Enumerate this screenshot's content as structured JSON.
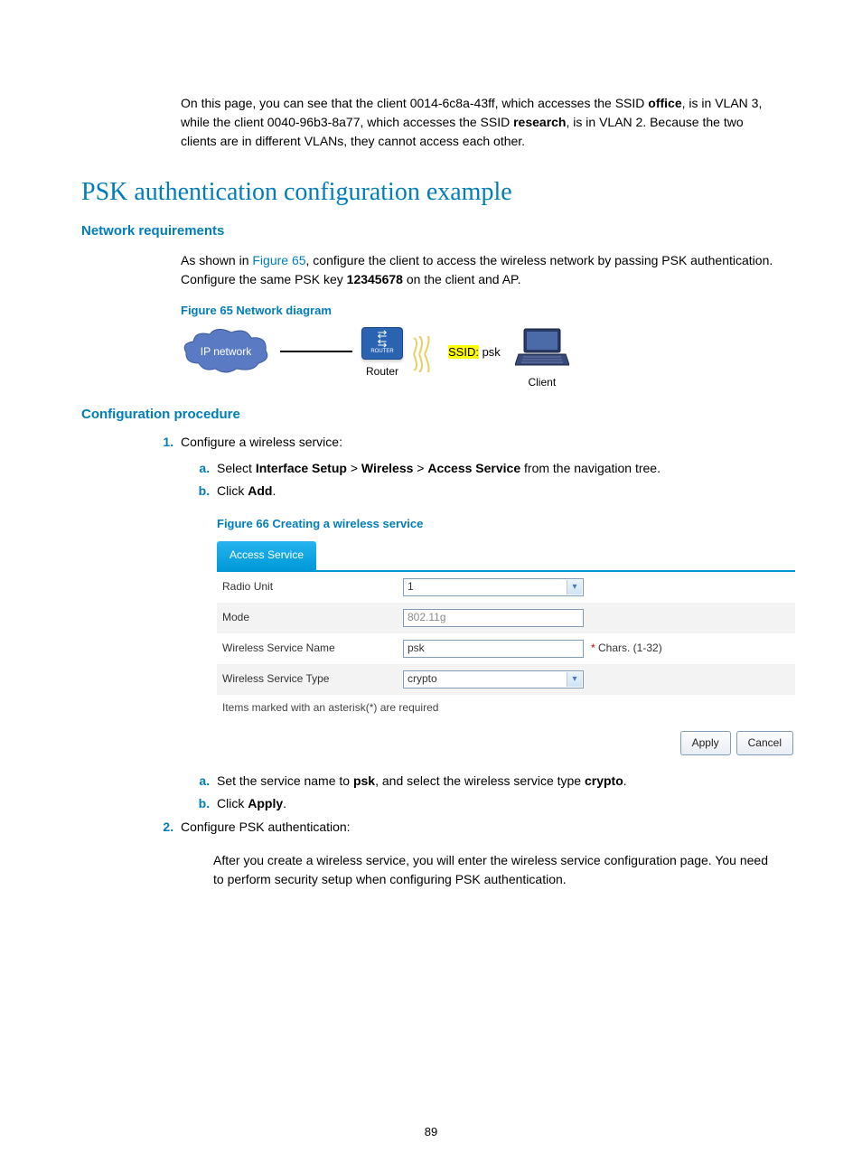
{
  "intro": {
    "p1a": "On this page, you can see that the client 0014-6c8a-43ff, which accesses the SSID ",
    "p1b_bold": "office",
    "p1c": ", is in VLAN 3, while the client 0040-96b3-8a77, which accesses the SSID ",
    "p1d_bold": "research",
    "p1e": ", is in VLAN 2. Because the two clients are in different VLANs, they cannot access each other."
  },
  "h1": "PSK authentication configuration example",
  "h2a": "Network requirements",
  "req": {
    "a": "As shown in ",
    "link": "Figure 65",
    "b": ", configure the client to access the wireless network by passing PSK authentication. Configure the same PSK key ",
    "key": "12345678",
    "c": " on the client and AP."
  },
  "fig65_caption": "Figure 65 Network diagram",
  "diagram": {
    "cloud": "IP network",
    "router": "Router",
    "router_small": "ROUTER",
    "ssid_lbl": "SSID:",
    "ssid_val": " psk",
    "client": "Client"
  },
  "h2b": "Configuration procedure",
  "step1": "Configure a wireless service:",
  "step1a_a": "Select ",
  "step1a_b1": "Interface Setup",
  "step1a_sep": " > ",
  "step1a_b2": "Wireless",
  "step1a_b3": "Access Service",
  "step1a_c": " from the navigation tree.",
  "step1b_a": "Click ",
  "step1b_b": "Add",
  "step1b_c": ".",
  "fig66_caption": "Figure 66 Creating a wireless service",
  "form": {
    "tab": "Access Service",
    "rows": {
      "radio_label": "Radio Unit",
      "radio_value": "1",
      "mode_label": "Mode",
      "mode_value": "802.11g",
      "name_label": "Wireless Service Name",
      "name_value": "psk",
      "name_hint": " Chars. (1-32)",
      "type_label": "Wireless Service Type",
      "type_value": "crypto"
    },
    "note": "Items marked with an asterisk(*) are required",
    "apply": "Apply",
    "cancel": "Cancel"
  },
  "step1c_a": "Set the service name to ",
  "step1c_b1": "psk",
  "step1c_mid": ", and select the wireless service type ",
  "step1c_b2": "crypto",
  "step1c_c": ".",
  "step1d_a": "Click ",
  "step1d_b": "Apply",
  "step1d_c": ".",
  "step2": "Configure PSK authentication:",
  "step2_after": "After you create a wireless service, you will enter the wireless service configuration page. You need to perform security setup when configuring PSK authentication.",
  "pagenum": "89"
}
